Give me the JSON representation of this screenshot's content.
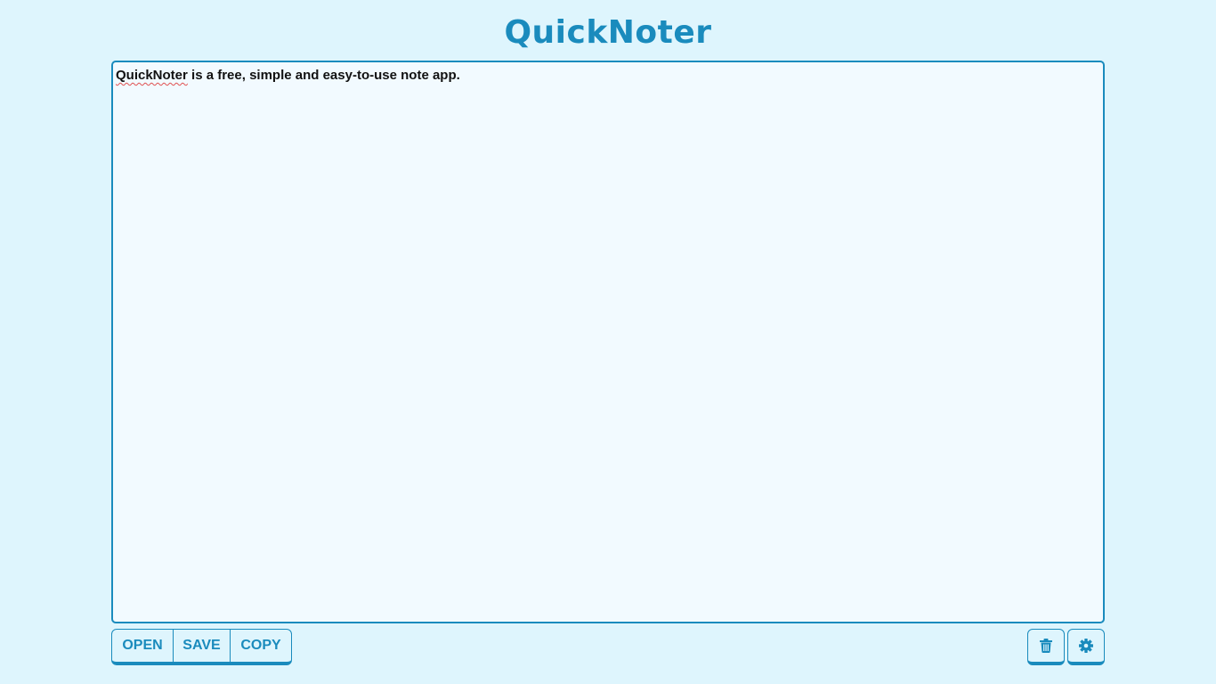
{
  "app": {
    "title": "QuickNoter"
  },
  "editor": {
    "misspelled_word": "QuickNoter",
    "rest_text": " is a free, simple and easy-to-use note app."
  },
  "toolbar": {
    "open_label": "OPEN",
    "save_label": "SAVE",
    "copy_label": "COPY",
    "delete_icon": "trash-icon",
    "settings_icon": "gear-icon"
  },
  "colors": {
    "background": "#def5fd",
    "accent": "#1a8bbd",
    "editor_background": "#f2faff",
    "spellcheck_underline": "#e05050"
  }
}
